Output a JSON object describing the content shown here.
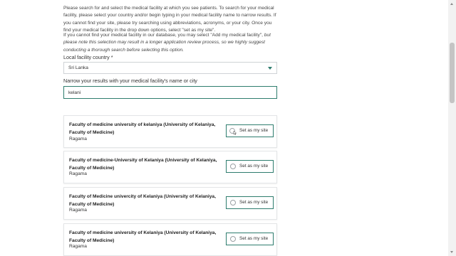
{
  "instructions": {
    "p1": "Please search for and select the medical facility at which you see patients. To search for your medical facility, please select your country and/or begin typing in your medical facility name to narrow results. If you cannot find your site, please try searching using abbreviations, acronyms, or your city. Once you find your medical facility in the drop down options, select \"set as my site\".",
    "p2_normal": "If you cannot find your medical facility in our database, you may select \"Add my medical facility\", ",
    "p2_italic": "but please note this selection may result in a longer application review process, so we highly suggest conducting a thorough search before selecting this option."
  },
  "country": {
    "label": "Local facility country *",
    "value": "Sri Lanka"
  },
  "search": {
    "label": "Narrow your results with your medical facility's name or city",
    "value": "kelani"
  },
  "results": [
    {
      "name": "Faculty of medicine university of kelaniya (University of Kelaniya, Faculty of Medicine)",
      "city": "Ragama",
      "button": "Set as my site"
    },
    {
      "name": "Faculty of medicine-University of Kelaniya (University of Kelaniya, Faculty of Medicine)",
      "city": "Ragama",
      "button": "Set as my site"
    },
    {
      "name": "Faculty of Medicine univercity of Kelaniya (University of Kelaniya, Faculty of Medicine)",
      "city": "Ragama",
      "button": "Set as my site"
    },
    {
      "name": "Faculty of medicine university of Kelaniya (University of Kelaniya, Faculty of Medicine)",
      "city": "Ragama",
      "button": "Set as my site"
    }
  ],
  "colors": {
    "accent": "#2e7d6e",
    "border": "#e3e5e7"
  }
}
